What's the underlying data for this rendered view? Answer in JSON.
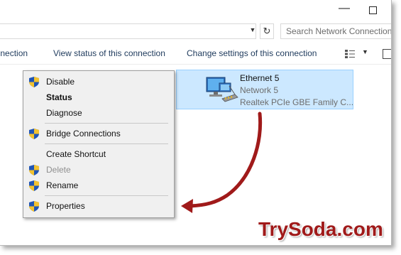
{
  "window": {
    "minimize_icon": "minimize-icon",
    "maximize_icon": "maximize-icon"
  },
  "address_bar": {
    "dropdown_icon": "chevron-down-icon",
    "refresh_icon": "refresh-icon",
    "search_placeholder": "Search Network Connections"
  },
  "command_bar": {
    "items": [
      {
        "label": "onnection"
      },
      {
        "label": "View status of this connection"
      },
      {
        "label": "Change settings of this connection"
      }
    ],
    "view_icon": "view-options-icon",
    "view_dropdown_icon": "chevron-down-icon",
    "pane_icon": "preview-pane-icon"
  },
  "adapter": {
    "name": "Ethernet 5",
    "network": "Network  5",
    "device": "Realtek PCIe GBE Family C...",
    "icon": "network-adapter-icon",
    "selection_color": "#cce8ff"
  },
  "context_menu": {
    "items": [
      {
        "label": "Disable",
        "shield": true,
        "bold": false,
        "disabled": false
      },
      {
        "label": "Status",
        "shield": false,
        "bold": true,
        "disabled": false
      },
      {
        "label": "Diagnose",
        "shield": false,
        "bold": false,
        "disabled": false
      },
      {
        "label": "Bridge Connections",
        "shield": true,
        "bold": false,
        "disabled": false
      },
      {
        "label": "Create Shortcut",
        "shield": false,
        "bold": false,
        "disabled": false
      },
      {
        "label": "Delete",
        "shield": true,
        "bold": false,
        "disabled": true
      },
      {
        "label": "Rename",
        "shield": true,
        "bold": false,
        "disabled": false
      },
      {
        "label": "Properties",
        "shield": true,
        "bold": false,
        "disabled": false
      }
    ],
    "shield_icon": "uac-shield-icon"
  },
  "annotation": {
    "arrow_color": "#a01a1a",
    "brand": "TrySoda.com"
  }
}
